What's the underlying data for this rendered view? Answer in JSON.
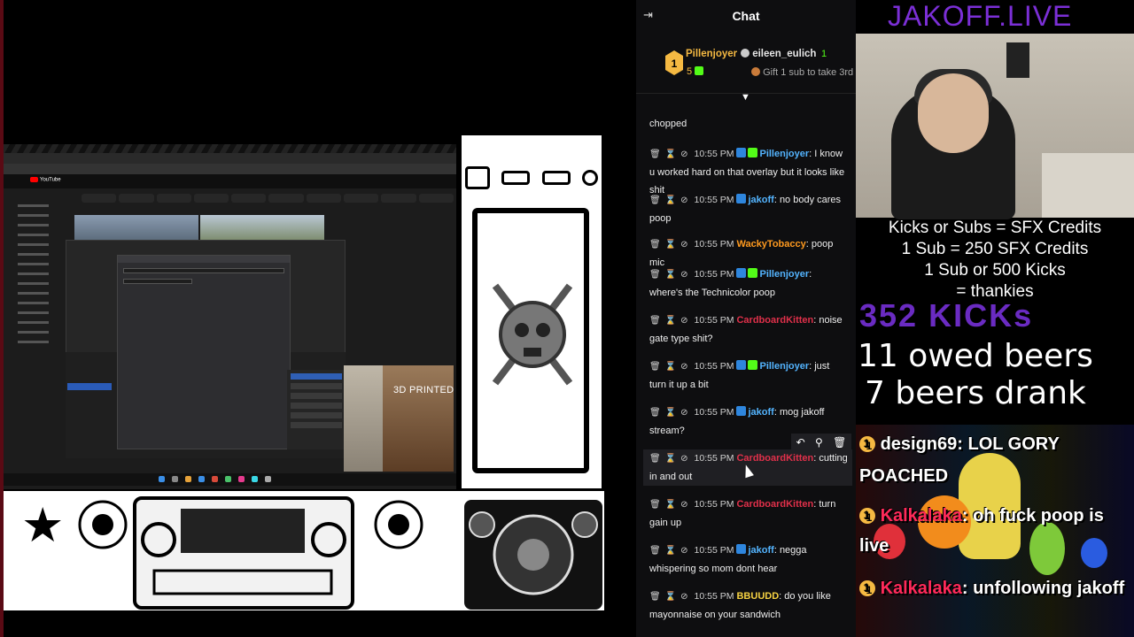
{
  "chat": {
    "title": "Chat",
    "leaderboard": {
      "first_user": "Pillenjoyer",
      "first_count": "5",
      "second_user": "eileen_eulich",
      "second_count": "1",
      "third_prompt": "Gift 1 sub to take 3rd"
    },
    "messages": [
      {
        "time": "",
        "user": "",
        "user_color": "#e6e6e6",
        "text": "chopped",
        "badge": ""
      },
      {
        "time": "10:55 PM",
        "user": "Pillenjoyer",
        "user_color": "#53b4ff",
        "text": ": I know u worked hard on that overlay but it looks like shit",
        "badge": "#53fc18"
      },
      {
        "time": "10:55 PM",
        "user": "jakoff",
        "user_color": "#53b4ff",
        "text": ": no body cares poop",
        "badge": "#2e86de"
      },
      {
        "time": "10:55 PM",
        "user": "WackyTobaccy",
        "user_color": "#ff9a1f",
        "text": ": poop mic",
        "badge": ""
      },
      {
        "time": "10:55 PM",
        "user": "Pillenjoyer",
        "user_color": "#53b4ff",
        "text": ": where's the Technicolor poop",
        "badge": "#53fc18"
      },
      {
        "time": "10:55 PM",
        "user": "CardboardKitten",
        "user_color": "#e0304a",
        "text": ": noise gate type shit?",
        "badge": ""
      },
      {
        "time": "10:55 PM",
        "user": "Pillenjoyer",
        "user_color": "#53b4ff",
        "text": ": just turn it up a bit",
        "badge": "#53fc18"
      },
      {
        "time": "10:55 PM",
        "user": "jakoff",
        "user_color": "#53b4ff",
        "text": ": mog jakoff stream?",
        "badge": "#2e86de"
      },
      {
        "time": "10:55 PM",
        "user": "CardboardKitten",
        "user_color": "#e0304a",
        "text": ": cutting in and out",
        "badge": ""
      },
      {
        "time": "10:55 PM",
        "user": "CardboardKitten",
        "user_color": "#e0304a",
        "text": ": turn gain up",
        "badge": ""
      },
      {
        "time": "10:55 PM",
        "user": "jakoff",
        "user_color": "#53b4ff",
        "text": ": negga whispering so mom dont hear",
        "badge": "#2e86de"
      },
      {
        "time": "10:55 PM",
        "user": "BBUUDD",
        "user_color": "#f5d142",
        "text": ": do you like mayonnaise on your sandwich",
        "badge": ""
      }
    ]
  },
  "overlay": {
    "brand": "JAKOFF.LIVE",
    "info_lines": [
      "Kicks or Subs = SFX Credits",
      "1 Sub = 250 SFX Credits",
      "1 Sub or 500 Kicks",
      "= thankies"
    ],
    "kicks_count": "352 KICKs",
    "owed_beers": "11 owed beers",
    "drank_beers": "7 beers drank",
    "alerts": [
      {
        "user": "design69",
        "text": ": LOL GORY POACHED"
      },
      {
        "user": "Kalkalaka",
        "text": ": oh fuck poop is live"
      },
      {
        "user": "Kalkalaka",
        "text": ": unfollowing jakoff"
      }
    ]
  },
  "capture": {
    "printed_label": "3D PRINTED",
    "yt_label": "YouTube"
  },
  "colors": {
    "brand_purple": "#7b2fd6",
    "kick_green": "#53fc18",
    "chat_bg": "#0e0e10"
  }
}
